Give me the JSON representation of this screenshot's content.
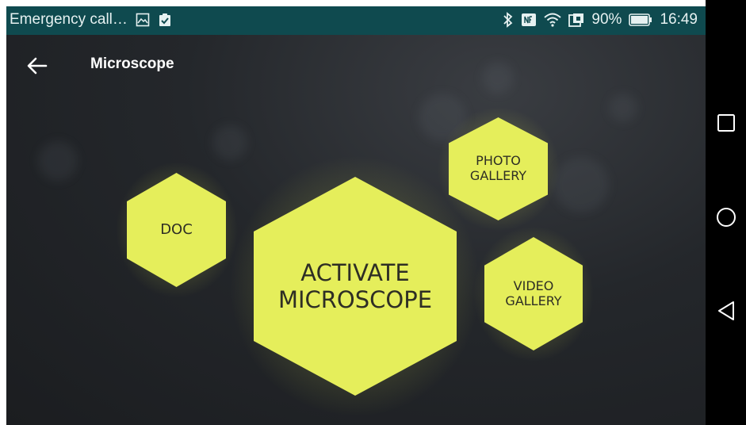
{
  "statusbar": {
    "carrier_text": "Emergency call…",
    "battery_percent": "90%",
    "time": "16:49",
    "icons_left": [
      "image-icon",
      "clipboard-check-icon"
    ],
    "icons_right": [
      "bluetooth-icon",
      "nfc-icon",
      "wifi-icon",
      "battery-saver-icon",
      "battery-icon"
    ]
  },
  "appbar": {
    "title": "Microscope"
  },
  "buttons": {
    "doc": "DOC",
    "activate": "ACTIVATE\nMICROSCOPE",
    "photo_gallery": "PHOTO\nGALLERY",
    "video_gallery": "VIDEO\nGALLERY"
  },
  "nav": [
    "recent-apps-icon",
    "home-icon",
    "back-triangle-icon"
  ],
  "colors": {
    "accent": "#e5ee5b",
    "statusbar": "#0f4a4f",
    "background": "#222528"
  }
}
